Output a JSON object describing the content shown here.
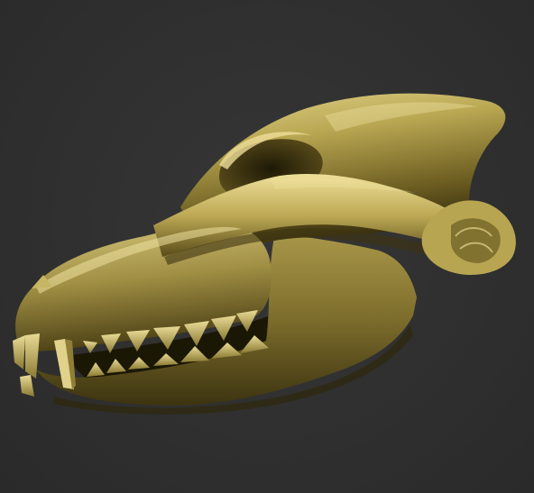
{
  "scene": {
    "subject": "skull-render",
    "background_color": "#303030",
    "material_color": "#9a8a3e",
    "material_highlight": "#e8d98e",
    "material_shadow": "#2a230c"
  }
}
